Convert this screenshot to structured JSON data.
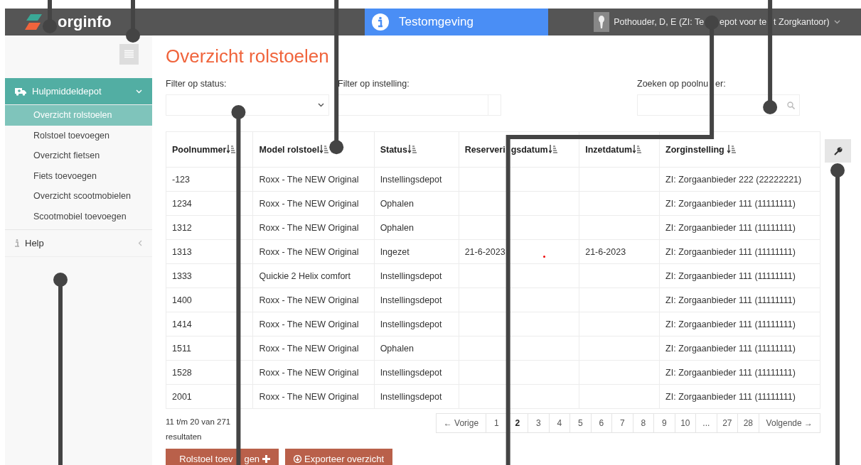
{
  "header": {
    "logo": "orginfo",
    "environment": "Testomgeving",
    "user": [
      "Pothouder, D, E (ZI: Te",
      "epot voor te",
      "t Zorgkantoor)"
    ]
  },
  "sidebar": {
    "items": [
      {
        "label": "Hulpmiddeldepot",
        "expanded": true,
        "children": [
          {
            "label": "Overzicht rolstoelen",
            "selected": true
          },
          {
            "label": "Rolstoel toevoegen",
            "selected": false
          },
          {
            "label": "Overzicht fietsen",
            "selected": false
          },
          {
            "label": "Fiets toevoegen",
            "selected": false
          },
          {
            "label": "Overzicht scootmobielen",
            "selected": false
          },
          {
            "label": "Scootmobiel toevoegen",
            "selected": false
          }
        ]
      },
      {
        "label": "Help",
        "expanded": false
      }
    ]
  },
  "page_title": "Overzicht rolstoelen",
  "filters": [
    {
      "label": [
        "Filter op status:"
      ],
      "kind": "select"
    },
    {
      "label": [
        "Filter op instelling:"
      ],
      "kind": "combo"
    },
    {
      "label": [
        "Zoeken op poolnu",
        "er:"
      ],
      "kind": "search"
    }
  ],
  "table": {
    "columns": [
      {
        "label": "Poolnummer"
      },
      {
        "label": "Model rolstoel"
      },
      {
        "label": "Status"
      },
      {
        "label": "Reserveri",
        "label_continued": "gsdatum"
      },
      {
        "label": "Inzetdatum"
      },
      {
        "label": "Zorginstelling "
      }
    ],
    "rows": [
      [
        "-123",
        "Roxx - The NEW Original",
        "Instellingsdepot",
        "",
        "",
        "ZI: Zorgaanbieder 222 (22222221)"
      ],
      [
        "1234",
        "Roxx - The NEW Original",
        "Ophalen",
        "",
        "",
        "ZI: Zorgaanbieder 111 (11111111)"
      ],
      [
        "1312",
        "Roxx - The NEW Original",
        "Ophalen",
        "",
        "",
        "ZI: Zorgaanbieder 111 (11111111)"
      ],
      [
        "1313",
        "Roxx - The NEW Original",
        "Ingezet",
        "21-6-2023",
        "21-6-2023",
        "ZI: Zorgaanbieder 111 (11111111)"
      ],
      [
        "1333",
        "Quickie 2 Helix comfort",
        "Instellingsdepot",
        "",
        "",
        "ZI: Zorgaanbieder 111 (11111111)"
      ],
      [
        "1400",
        "Roxx - The NEW Original",
        "Instellingsdepot",
        "",
        "",
        "ZI: Zorgaanbieder 111 (11111111)"
      ],
      [
        "1414",
        "Roxx - The NEW Original",
        "Instellingsdepot",
        "",
        "",
        "ZI: Zorgaanbieder 111 (11111111)"
      ],
      [
        "1511",
        "Roxx - The NEW Original",
        "Ophalen",
        "",
        "",
        "ZI: Zorgaanbieder 111 (11111111)"
      ],
      [
        "1528",
        "Roxx - The NEW Original",
        "Instellingsdepot",
        "",
        "",
        "ZI: Zorgaanbieder 111 (11111111)"
      ],
      [
        "2001",
        "Roxx - The NEW Original",
        "Instellingsdepot",
        "",
        "",
        "ZI: Zorgaanbieder 111 (11111111)"
      ]
    ]
  },
  "result_count": "11 t/m 20 van 271 resultaten",
  "pagination": [
    {
      "label": "← Vorige",
      "selected": false
    },
    {
      "label": "1",
      "selected": false
    },
    {
      "label": "2",
      "selected": true
    },
    {
      "label": "3",
      "selected": false
    },
    {
      "label": "4",
      "selected": false
    },
    {
      "label": "5",
      "selected": false
    },
    {
      "label": "6",
      "selected": false
    },
    {
      "label": "7",
      "selected": false
    },
    {
      "label": "8",
      "selected": false
    },
    {
      "label": "9",
      "selected": false
    },
    {
      "label": "10",
      "selected": false
    },
    {
      "label": "...",
      "selected": false
    },
    {
      "label": "27",
      "selected": false
    },
    {
      "label": "28",
      "selected": false
    },
    {
      "label": "Volgende →",
      "selected": false
    }
  ],
  "buttons": [
    [
      "Rolstoel toev",
      "gen"
    ],
    [
      "Exporteer overzicht"
    ]
  ]
}
